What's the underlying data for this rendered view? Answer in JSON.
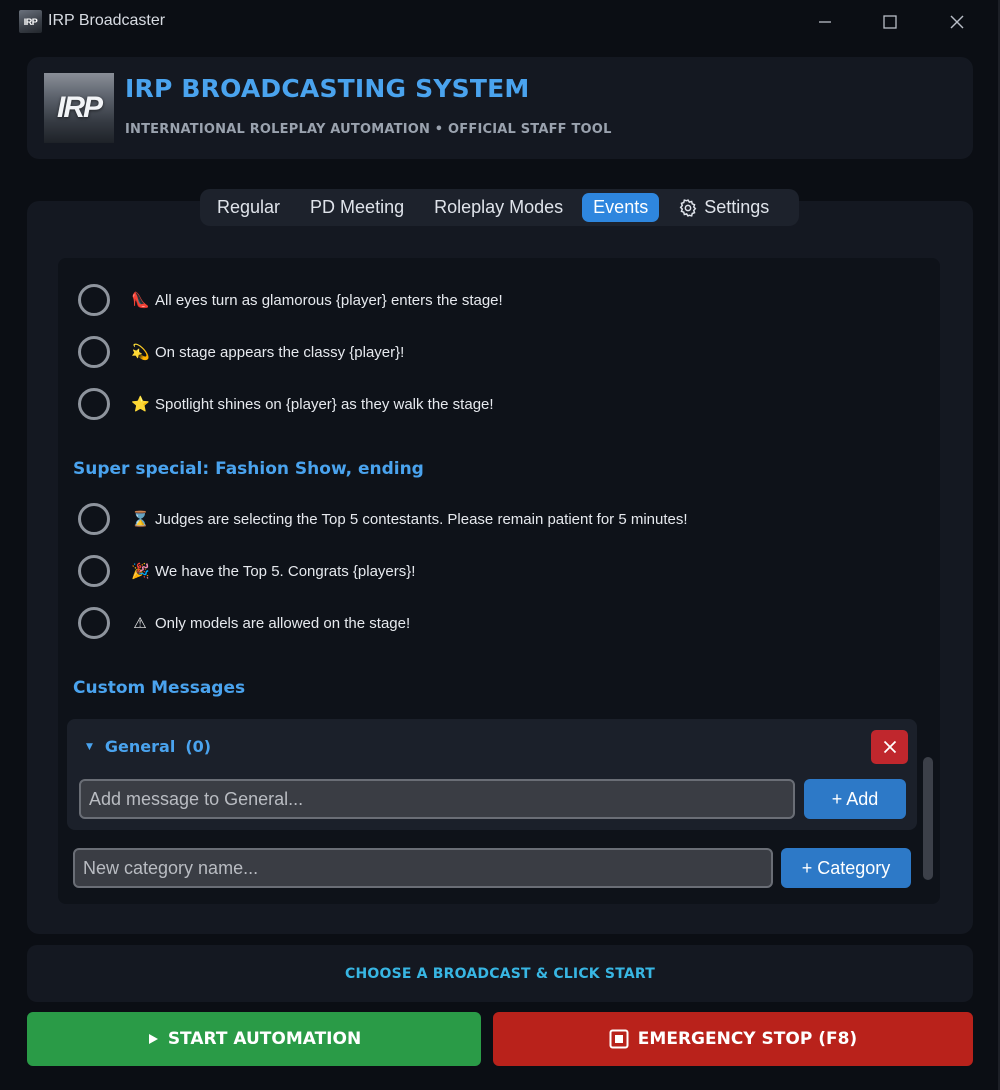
{
  "window": {
    "title": "IRP Broadcaster",
    "icon_text": "IRP"
  },
  "header": {
    "logo_text": "IRP",
    "title": "IRP BROADCASTING SYSTEM",
    "subtitle": "INTERNATIONAL ROLEPLAY AUTOMATION • OFFICIAL STAFF TOOL"
  },
  "tabs": [
    {
      "label": "Regular",
      "active": false
    },
    {
      "label": "PD Meeting",
      "active": false
    },
    {
      "label": "Roleplay Modes",
      "active": false
    },
    {
      "label": "Events",
      "active": true
    },
    {
      "label": "Settings",
      "active": false,
      "icon": "gear-icon"
    }
  ],
  "events": {
    "group1": [
      {
        "emoji": "👠",
        "text": "All eyes turn as glamorous {player} enters the stage!"
      },
      {
        "emoji": "💫",
        "text": "On stage appears the classy {player}!"
      },
      {
        "emoji": "⭐",
        "text": "Spotlight shines on {player} as they walk the stage!"
      }
    ],
    "section2_title": "Super special: Fashion Show, ending",
    "group2": [
      {
        "emoji": "⌛",
        "text": "Judges are selecting the Top 5 contestants. Please remain patient for 5 minutes!"
      },
      {
        "emoji": "🎉",
        "text": "We have the Top 5. Congrats {players}!"
      },
      {
        "emoji": "⚠",
        "text": "Only models are allowed on the stage!"
      }
    ]
  },
  "custom": {
    "title": "Custom Messages",
    "category_name": "General",
    "category_count": "(0)",
    "message_placeholder": "Add message to General...",
    "add_label": "+ Add",
    "category_placeholder": "New category name...",
    "category_button_label": "+ Category"
  },
  "status": {
    "text": "CHOOSE A BROADCAST & CLICK START"
  },
  "controls": {
    "start_label": "START AUTOMATION",
    "stop_label": "EMERGENCY STOP (F8)"
  },
  "colors": {
    "accent": "#4aa3ee",
    "tab_active": "#2e86de",
    "start": "#2a9b47",
    "stop": "#b9221b",
    "delete": "#c0272d"
  }
}
